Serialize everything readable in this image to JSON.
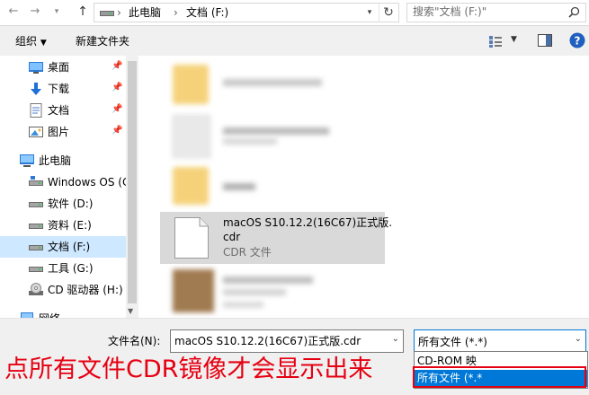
{
  "address": {
    "crumbs": [
      "此电脑",
      "文档 (F:)"
    ],
    "separator": "›"
  },
  "search": {
    "placeholder": "搜索\"文档 (F:)\""
  },
  "command_bar": {
    "organize": "组织",
    "new_folder": "新建文件夹"
  },
  "nav": {
    "items": [
      {
        "label": "桌面",
        "icon": "desktop-icon",
        "pinned": true
      },
      {
        "label": "下载",
        "icon": "download-icon",
        "pinned": true
      },
      {
        "label": "文档",
        "icon": "document-icon",
        "pinned": true
      },
      {
        "label": "图片",
        "icon": "picture-icon",
        "pinned": true
      },
      {
        "label": "此电脑",
        "icon": "computer-icon",
        "pinned": false
      },
      {
        "label": "Windows OS (C",
        "icon": "drive-icon",
        "pinned": false
      },
      {
        "label": "软件 (D:)",
        "icon": "drive-icon",
        "pinned": false
      },
      {
        "label": "资料 (E:)",
        "icon": "drive-icon",
        "pinned": false
      },
      {
        "label": "文档 (F:)",
        "icon": "drive-icon",
        "pinned": false,
        "selected": true
      },
      {
        "label": "工具 (G:)",
        "icon": "drive-icon",
        "pinned": false
      },
      {
        "label": "CD 驱动器 (H:)",
        "icon": "cd-drive-icon",
        "pinned": false
      },
      {
        "label": "网络",
        "icon": "network-icon",
        "pinned": false
      }
    ]
  },
  "files": {
    "selected": {
      "name_line1": "macOS S10.12.2(16C67)正式版.",
      "name_line2": "cdr",
      "type": "CDR 文件"
    }
  },
  "bottom": {
    "filename_label": "文件名(N):",
    "filename_value": "macOS S10.12.2(16C67)正式版.cdr",
    "filetype_selected": "所有文件 (*.*)",
    "filetype_options": [
      "CD-ROM 映",
      "所有文件 (*.*"
    ]
  },
  "annotation": {
    "caption": "点所有文件CDR镜像才会显示出来",
    "color": "#e60012"
  },
  "colors": {
    "accent": "#0078d7",
    "selection": "#cde8ff",
    "folder": "#f8d775"
  }
}
